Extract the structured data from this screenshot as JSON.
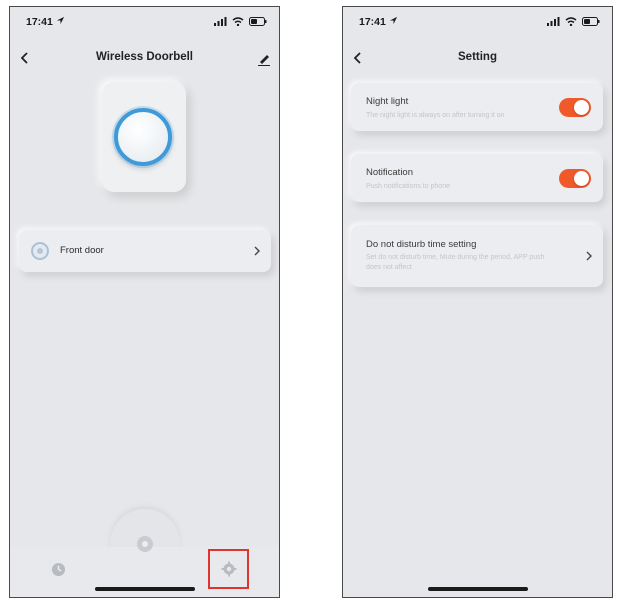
{
  "left_screen": {
    "status_time": "17:41",
    "title": "Wireless Doorbell",
    "device_list": [
      {
        "label": "Front door"
      }
    ]
  },
  "right_screen": {
    "status_time": "17:41",
    "title": "Setting",
    "settings": [
      {
        "title": "Night light",
        "description": "The night light is always on after turning it on",
        "toggle_on": true
      },
      {
        "title": "Notification",
        "description": "Push notifications to phone",
        "toggle_on": true
      },
      {
        "title": "Do not disturb time setting",
        "description": "Set do not disturb time, Mute during the period, APP push does not affect"
      }
    ]
  },
  "colors": {
    "accent_toggle": "#f05a2a",
    "device_ring": "#3e9ad8",
    "highlight_box": "#e0342f",
    "background": "#e6e7ea"
  },
  "icons": [
    "back-icon",
    "edit-icon",
    "chevron-right-icon",
    "clock-icon",
    "settings-gear-icon",
    "home-icon",
    "location-arrow-icon",
    "signal-icon",
    "wifi-icon",
    "battery-icon"
  ]
}
